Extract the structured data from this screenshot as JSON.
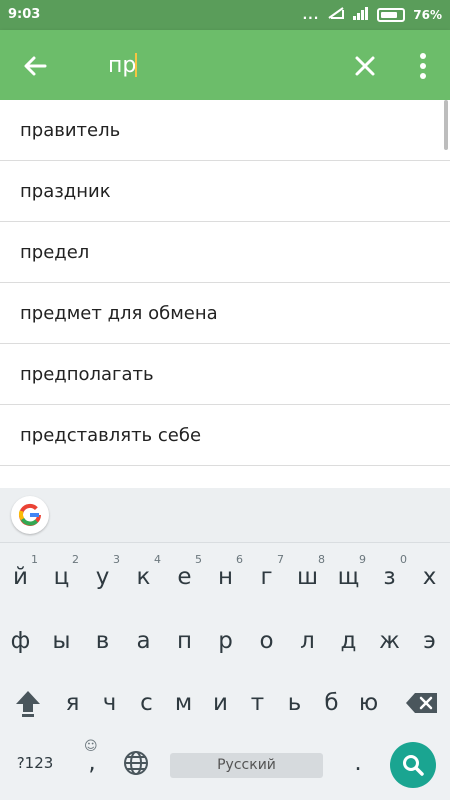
{
  "status_bar": {
    "time": "9:03",
    "battery_percent": "76%",
    "notification_dots": "..."
  },
  "app_bar": {
    "query": "пр",
    "accent_color": "#6cbd6a"
  },
  "suggestions": [
    "правитель",
    "праздник",
    "предел",
    "предмет для обмена",
    "предполагать",
    "представлять себе"
  ],
  "keyboard": {
    "row1": [
      {
        "char": "й",
        "hint": "1"
      },
      {
        "char": "ц",
        "hint": "2"
      },
      {
        "char": "у",
        "hint": "3"
      },
      {
        "char": "к",
        "hint": "4"
      },
      {
        "char": "е",
        "hint": "5"
      },
      {
        "char": "н",
        "hint": "6"
      },
      {
        "char": "г",
        "hint": "7"
      },
      {
        "char": "ш",
        "hint": "8"
      },
      {
        "char": "щ",
        "hint": "9"
      },
      {
        "char": "з",
        "hint": "0"
      },
      {
        "char": "х",
        "hint": ""
      }
    ],
    "row2": [
      "ф",
      "ы",
      "в",
      "а",
      "п",
      "р",
      "о",
      "л",
      "д",
      "ж",
      "э"
    ],
    "row3": [
      "я",
      "ч",
      "с",
      "м",
      "и",
      "т",
      "ь",
      "б",
      "ю"
    ],
    "symbols_label": "?123",
    "comma_label": ",",
    "space_label": "Русский",
    "period_label": "."
  }
}
